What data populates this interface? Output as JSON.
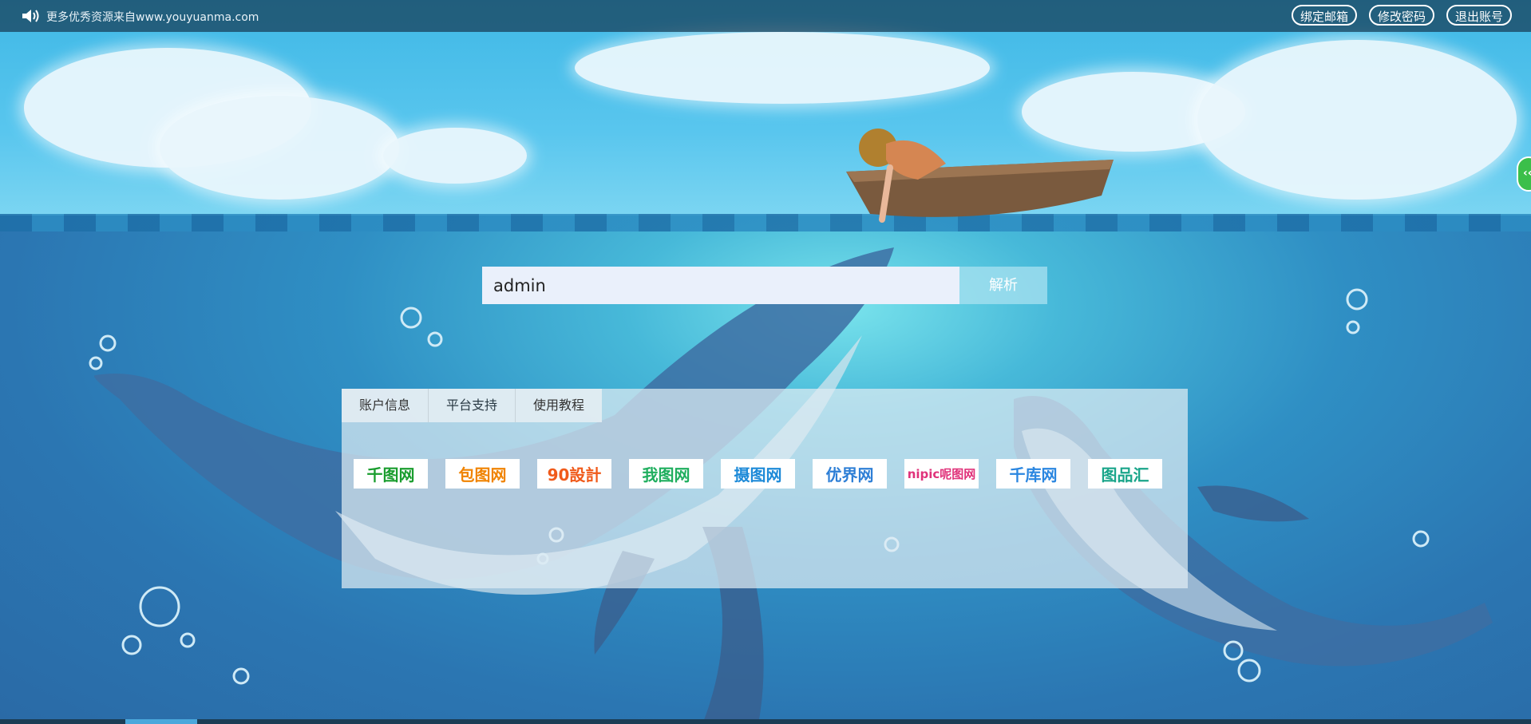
{
  "topbar": {
    "notice": "更多优秀资源来自www.youyuanma.com",
    "buttons": {
      "bind_email": "绑定邮箱",
      "change_password": "修改密码",
      "logout": "退出账号"
    }
  },
  "side_handle": {
    "label": "‹‹"
  },
  "search": {
    "value": "admin",
    "button_label": "解析"
  },
  "panel": {
    "tabs": [
      "账户信息",
      "平台支持",
      "使用教程"
    ],
    "platforms": [
      {
        "name": "千图网",
        "color": "#1a9d2e"
      },
      {
        "name": "包图网",
        "color": "#f08300"
      },
      {
        "name": "90設計",
        "color": "#f05a1a"
      },
      {
        "name": "我图网",
        "color": "#1fae5e"
      },
      {
        "name": "摄图网",
        "color": "#1d8ad8"
      },
      {
        "name": "优界网",
        "color": "#2e7fd6"
      },
      {
        "name": "nipic呢图网",
        "color": "#e0327a"
      },
      {
        "name": "千库网",
        "color": "#2a86e0"
      },
      {
        "name": "图品汇",
        "color": "#1aa58a"
      }
    ]
  }
}
